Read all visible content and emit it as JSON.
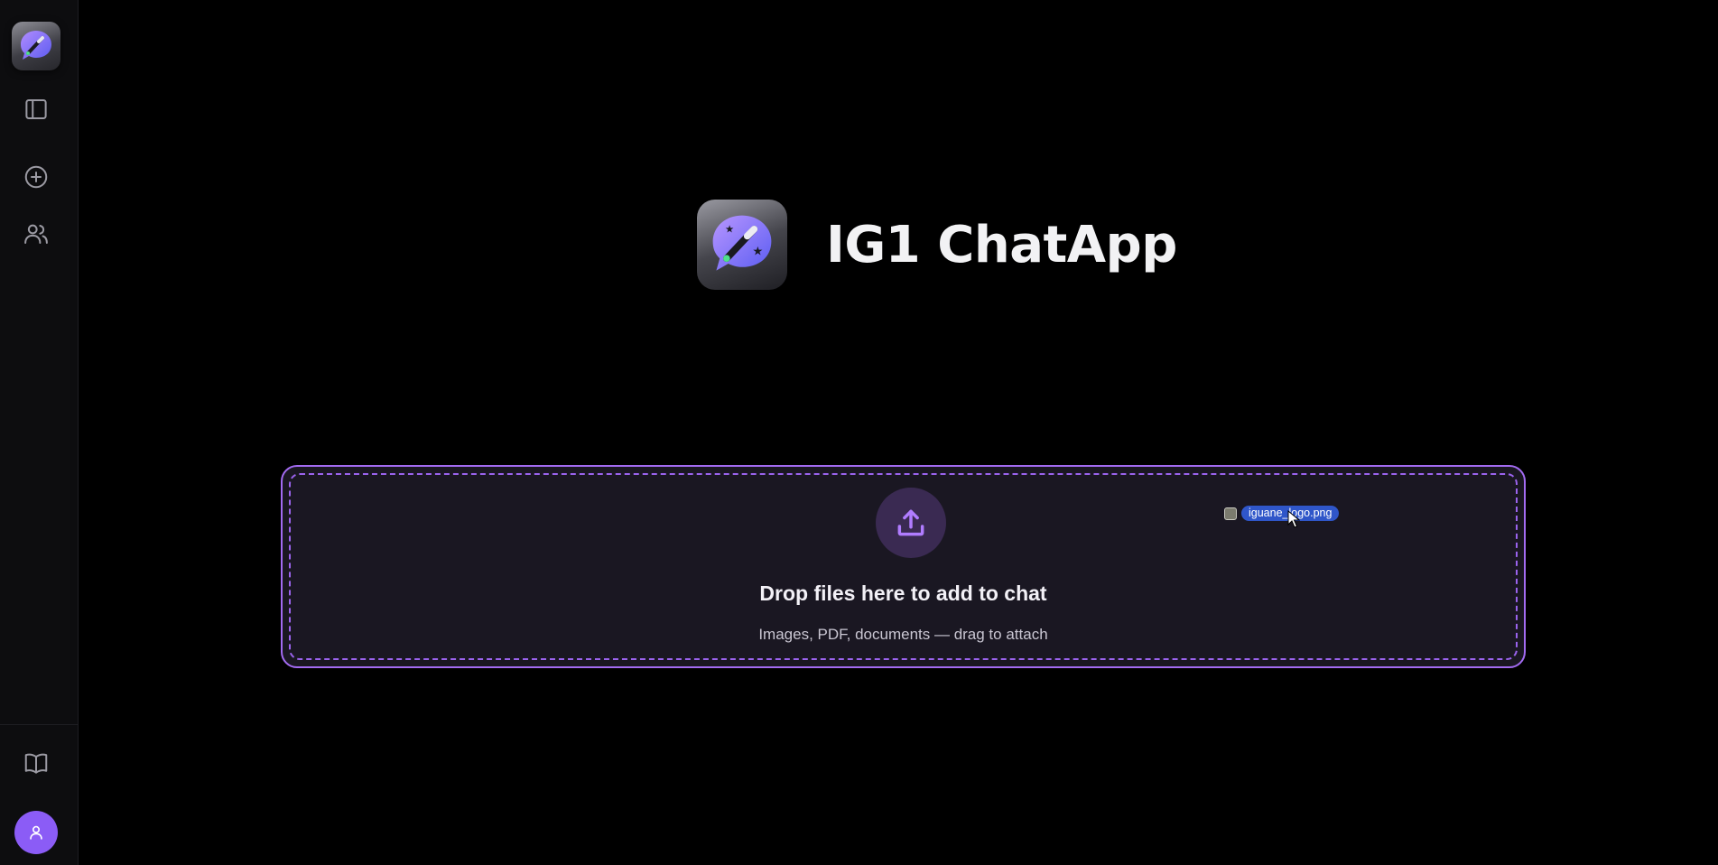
{
  "app": {
    "title": "IG1 ChatApp",
    "accent_color": "#8b5cf6"
  },
  "sidebar": {
    "logo_icon": "magic-chat-logo-icon",
    "items": [
      {
        "name": "toggle-sidebar",
        "icon": "sidebar-panel-icon"
      },
      {
        "name": "new-chat",
        "icon": "plus-circle-icon"
      },
      {
        "name": "users",
        "icon": "users-icon"
      }
    ],
    "bottom": [
      {
        "name": "library",
        "icon": "book-open-icon"
      },
      {
        "name": "profile",
        "icon": "user-icon"
      }
    ]
  },
  "dropzone": {
    "icon": "upload-icon",
    "title": "Drop files here to add to chat",
    "subtitle": "Images, PDF, documents — drag to attach"
  },
  "drag": {
    "file_name": "iguane_logo.png"
  }
}
